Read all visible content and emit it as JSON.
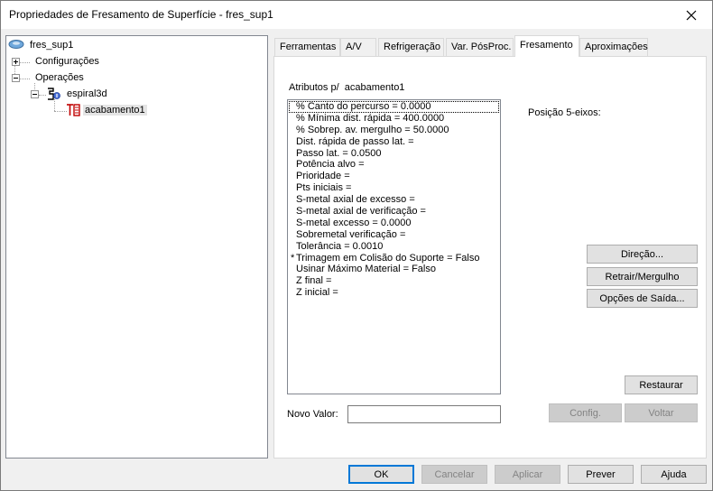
{
  "window": {
    "title": "Propriedades de Fresamento de Superfície - fres_sup1"
  },
  "tree": {
    "root": "fres_sup1",
    "configuracoes": "Configurações",
    "operacoes": "Operações",
    "spiral": "espiral3d",
    "finishing": "acabamento1"
  },
  "tabs": [
    "Ferramentas",
    "A/V",
    "Refrigeração",
    "Var. PósProc.",
    "Fresamento",
    "Aproximações"
  ],
  "main": {
    "attributes_label": "Atributos p/",
    "attributes_target": "acabamento1",
    "position_label": "Posição 5-eixos:",
    "new_value_label": "Novo Valor:",
    "new_value": "",
    "attributes": [
      "% Canto do percurso = 0.0000",
      "% Mínima dist. rápida = 400.0000",
      "% Sobrep. av. mergulho = 50.0000",
      "Dist. rápida de passo lat. =",
      "Passo lat. = 0.0500",
      "Potência alvo =",
      "Prioridade =",
      "Pts iniciais =",
      "S-metal axial de excesso =",
      "S-metal axial de verificação =",
      "S-metal excesso = 0.0000",
      "Sobremetal verificação =",
      "Tolerância = 0.0010",
      "Trimagem em Colisão do Suporte = Falso",
      "Usinar Máximo Material = Falso",
      "Z final =",
      "Z inicial ="
    ],
    "attribute_marker": "*"
  },
  "buttons": {
    "direcao": "Direção...",
    "retrair": "Retrair/Mergulho",
    "opcoes": "Opções de Saída...",
    "restaurar": "Restaurar",
    "config": "Config.",
    "voltar": "Voltar",
    "ok": "OK",
    "cancelar": "Cancelar",
    "aplicar": "Aplicar",
    "prever": "Prever",
    "ajuda": "Ajuda"
  }
}
